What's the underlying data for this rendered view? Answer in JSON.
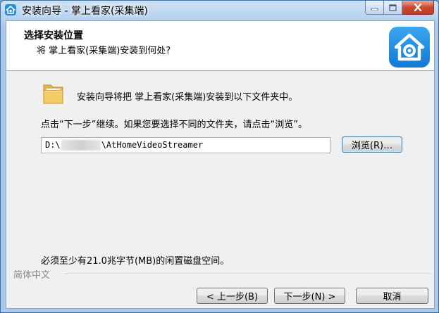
{
  "window": {
    "title": "安装向导 - 掌上看家(采集端)"
  },
  "header": {
    "title": "选择安装位置",
    "subtitle": "将 掌上看家(采集端)安装到何处?"
  },
  "main": {
    "intro_text": "安装向导将把 掌上看家(采集端)安装到以下文件夹中。",
    "instruction_text": "点击“下一步”继续。如果您要选择不同的文件夹，请点击“浏览”。",
    "path_prefix": "D:\\",
    "path_suffix": "\\AtHomeVideoStreamer",
    "browse_label": "浏览(R)…",
    "space_required": "必须至少有21.0兆字节(MB)的闲置磁盘空间。"
  },
  "footer": {
    "language": "简体中文",
    "back_label": "< 上一步(B)",
    "next_label": "下一步(N) >",
    "cancel_label": "取消"
  },
  "colors": {
    "accent": "#1e8fe0",
    "close": "#c74a34"
  },
  "icons": [
    "app-icon",
    "logo-icon",
    "folder-icon",
    "minimize-icon",
    "maximize-icon",
    "close-icon"
  ]
}
